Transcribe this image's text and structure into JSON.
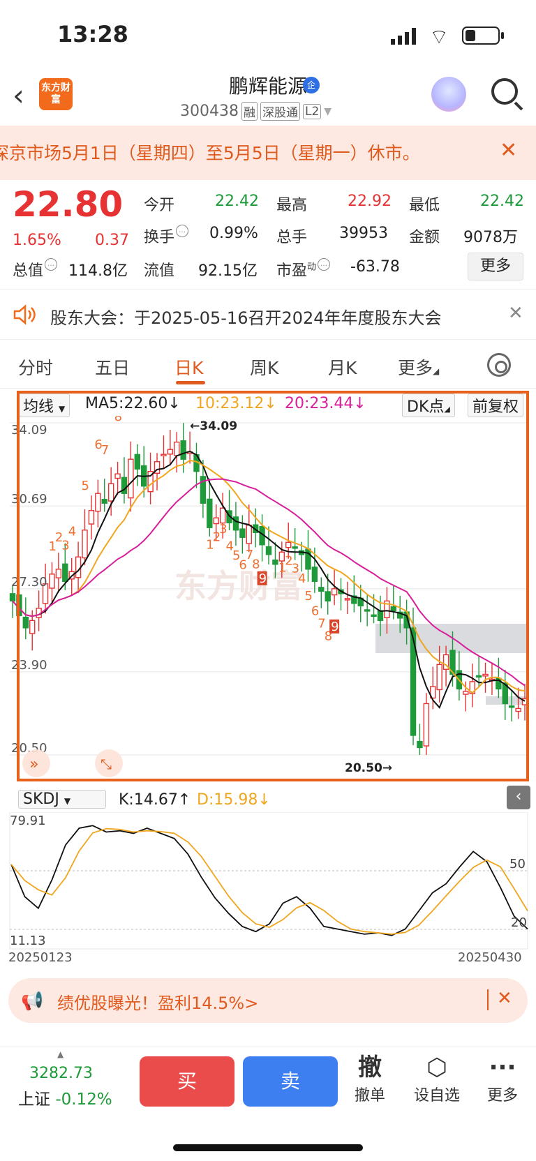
{
  "status": {
    "time": "13:28"
  },
  "header": {
    "logo": "东方财富",
    "name": "鹏辉能源",
    "badge": "企",
    "code": "300438",
    "tags": [
      "融",
      "深股通",
      "L2"
    ]
  },
  "notice_market": {
    "text": "深京市场5月1日（星期四）至5月5日（星期一）休市。"
  },
  "quote": {
    "price": "22.80",
    "pct": "1.65%",
    "change": "0.37",
    "open_label": "今开",
    "open": "22.42",
    "high_label": "最高",
    "high": "22.92",
    "low_label": "最低",
    "low": "22.42",
    "turnover_label": "换手",
    "turnover": "0.99%",
    "vol_label": "总手",
    "vol": "39953",
    "amount_label": "金额",
    "amount": "9078万",
    "mktcap_label": "总值",
    "mktcap": "114.8亿",
    "float_label": "流值",
    "float": "92.15亿",
    "pe_label": "市盈",
    "pe_sup": "动",
    "pe": "-63.78",
    "more": "更多"
  },
  "notice_meeting": {
    "text": "股东大会：于2025-05-16召开2024年年度股东大会"
  },
  "tabs": [
    "分时",
    "五日",
    "日K",
    "周K",
    "月K",
    "更多"
  ],
  "ma": {
    "dropdown": "均线",
    "ma5": "MA5:22.60↓",
    "ma10": "10:23.12↓",
    "ma20": "20:23.44↓",
    "dk": "DK点",
    "adj": "前复权"
  },
  "colors": {
    "up": "#e63232",
    "down": "#1e9a3a",
    "ma5": "#111111",
    "ma10": "#f0a61e",
    "ma20": "#d81e9a",
    "accent": "#e8611a"
  },
  "chart_data": [
    {
      "type": "candlestick",
      "y_ticks": [
        "34.09",
        "30.69",
        "27.30",
        "23.90",
        "20.50"
      ],
      "ylim": [
        20.5,
        34.09
      ],
      "annotations": {
        "max": "←34.09",
        "min": "20.50→"
      },
      "series": [
        "MA5",
        "MA10",
        "MA20"
      ],
      "td_up_labels": [
        "1",
        "2",
        "3",
        "4",
        "5",
        "6",
        "7",
        "8",
        "9"
      ],
      "td_down_labels": [
        "1",
        "2",
        "3",
        "4",
        "5",
        "6",
        "7",
        "8",
        "9"
      ],
      "watermark": "东方财富"
    },
    {
      "type": "line",
      "indicator": "SKDJ",
      "k_label": "K:14.67↑",
      "d_label": "D:15.98↓",
      "y_ticks": [
        "79.91",
        "11.13"
      ],
      "right_ticks": [
        "50",
        "20"
      ],
      "x_start": "20250123",
      "x_end": "20250430"
    }
  ],
  "promo": {
    "text": "绩优股曝光！盈利14.5%>"
  },
  "bottom": {
    "index_value": "3282.73",
    "index_name": "上证",
    "index_pct": "-0.12%",
    "buy": "买",
    "sell": "卖",
    "cancel_icon": "撤",
    "cancel": "撤单",
    "watch": "设自选",
    "more": "更多"
  }
}
